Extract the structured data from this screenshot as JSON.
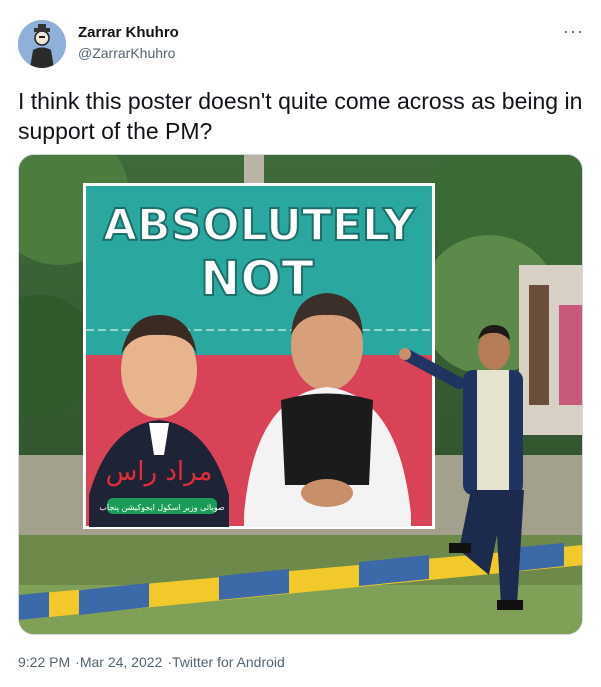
{
  "author": {
    "display_name": "Zarrar Khuhro",
    "handle": "@ZarrarKhuhro"
  },
  "more_icon": "more-horizontal-icon",
  "tweet": {
    "text": "I think this poster doesn't quite come across as being in support of the PM?"
  },
  "poster": {
    "headline_line1": "ABSOLUTELY",
    "headline_line2": "NOT",
    "urdu_name": "مراد راس",
    "urdu_caption": "صوبائی وزیر اسکول ایجوکیشن پنجاب"
  },
  "meta": {
    "time": "9:22 PM",
    "separator": "·",
    "date": "Mar 24, 2022",
    "source": "Twitter for Android"
  },
  "colors": {
    "text_primary": "#0f1419",
    "text_secondary": "#536471",
    "poster_teal": "#2aa8a0",
    "poster_red": "#d94358"
  }
}
